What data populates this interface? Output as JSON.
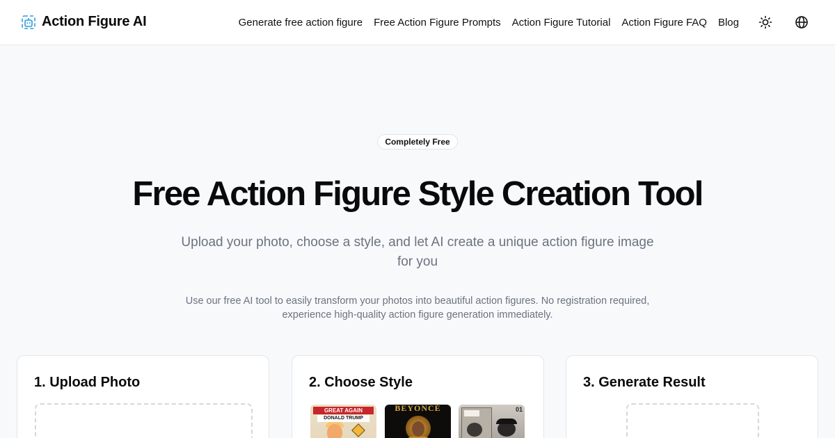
{
  "header": {
    "brand": "Action Figure AI",
    "nav": [
      "Generate free action figure",
      "Free Action Figure Prompts",
      "Action Figure Tutorial",
      "Action Figure FAQ",
      "Blog"
    ],
    "icons": [
      "theme-toggle-sun-icon",
      "language-globe-icon"
    ]
  },
  "hero": {
    "badge": "Completely Free",
    "title": "Free Action Figure Style Creation Tool",
    "subtitle": "Upload your photo, choose a style, and let AI create a unique action figure image for you",
    "description": "Use our free AI tool to easily transform your photos into beautiful action figures. No registration required, experience high-quality action figure generation immediately."
  },
  "steps": [
    {
      "title": "1. Upload Photo"
    },
    {
      "title": "2. Choose Style"
    },
    {
      "title": "3. Generate Result"
    }
  ],
  "styles": {
    "thumb1": {
      "banner": "GREAT AGAIN",
      "name": "DONALD TRUMP"
    },
    "thumb2": {
      "banner": "BEYONCÉ"
    },
    "thumb3": {
      "number": "01"
    }
  },
  "colors": {
    "brand_icon": "#2d9cdb",
    "background": "#f8f9fb",
    "text_muted": "#6b7280"
  }
}
